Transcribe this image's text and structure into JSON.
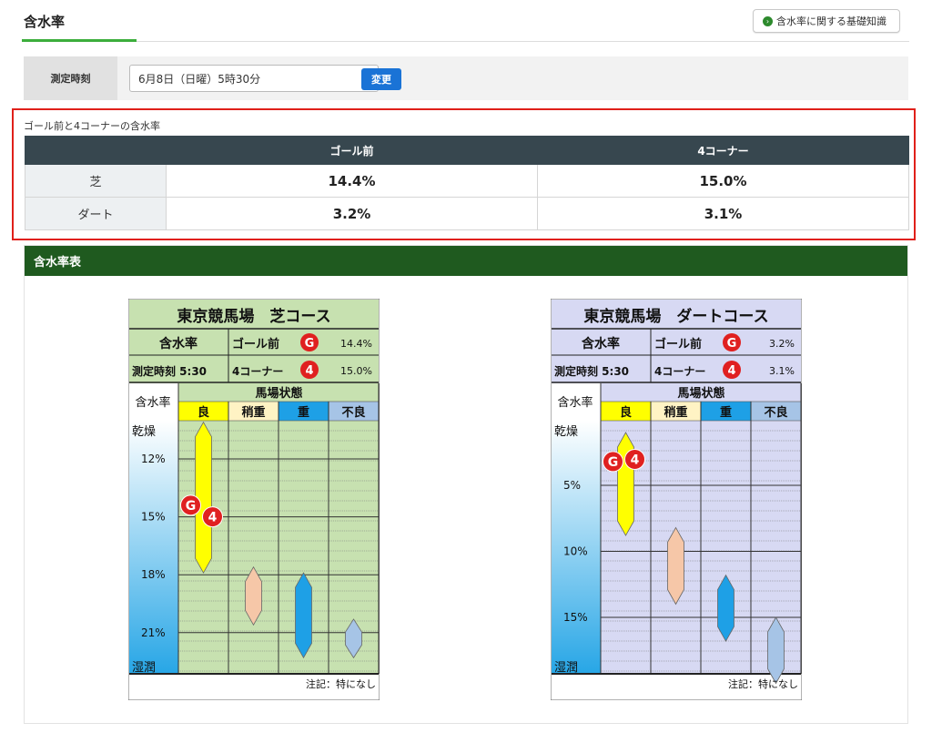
{
  "header": {
    "title": "含水率",
    "help_button": "含水率に関する基礎知識"
  },
  "control": {
    "label": "測定時刻",
    "selected": "6月8日（日曜）5時30分",
    "change_button": "変更"
  },
  "summary": {
    "caption": "ゴール前と4コーナーの含水率",
    "columns": [
      "ゴール前",
      "4コーナー"
    ],
    "rows": [
      {
        "label": "芝",
        "goal": "14.4%",
        "corner": "15.0%"
      },
      {
        "label": "ダート",
        "goal": "3.2%",
        "corner": "3.1%"
      }
    ]
  },
  "section": {
    "title": "含水率表"
  },
  "charts": {
    "turf": {
      "title": "東京競馬場　芝コース",
      "label_moisture": "含水率",
      "goal_label": "ゴール前",
      "goal_badge": "G",
      "goal_value": "14.4%",
      "time_label": "測定時刻 5:30",
      "corner_label": "4コーナー",
      "corner_badge": "4",
      "corner_value": "15.0%",
      "axis_title": "含水率",
      "track_condition": "馬場状態",
      "conditions": [
        "良",
        "稍重",
        "重",
        "不良"
      ],
      "axis_top": "乾燥",
      "axis_bottom": "湿潤",
      "ticks": [
        "12%",
        "15%",
        "18%",
        "21%"
      ],
      "note": "注記：特になし",
      "ranges": {
        "good": [
          10.1,
          17.9
        ],
        "slightly_heavy": [
          17.6,
          20.6
        ],
        "heavy": [
          17.9,
          22.3
        ],
        "bad": [
          20.3,
          22.3
        ]
      },
      "markers": {
        "goal": 14.4,
        "corner": 15.0
      },
      "colors": {
        "bg": "#c7e1b0",
        "border": "#333333"
      }
    },
    "dirt": {
      "title": "東京競馬場　ダートコース",
      "label_moisture": "含水率",
      "goal_label": "ゴール前",
      "goal_badge": "G",
      "goal_value": "3.2%",
      "time_label": "測定時刻 5:30",
      "corner_label": "4コーナー",
      "corner_badge": "4",
      "corner_value": "3.1%",
      "axis_title": "含水率",
      "track_condition": "馬場状態",
      "conditions": [
        "良",
        "稍重",
        "重",
        "不良"
      ],
      "axis_top": "乾燥",
      "axis_bottom": "湿潤",
      "ticks": [
        "5%",
        "10%",
        "15%"
      ],
      "note": "注記：特になし",
      "ranges": {
        "good": [
          1.0,
          8.8
        ],
        "slightly_heavy": [
          8.2,
          14.0
        ],
        "heavy": [
          11.8,
          16.8
        ],
        "bad": [
          15.0,
          20.0
        ]
      },
      "markers": {
        "goal": 3.2,
        "corner": 3.1
      },
      "colors": {
        "bg": "#d7d9f3",
        "border": "#333333"
      }
    }
  },
  "colors": {
    "accent_green": "#3cae3c",
    "button_blue": "#1a73d6",
    "table_header": "#37474f",
    "section_header": "#1f5a1f",
    "highlight_border": "#e0201a",
    "good": "#ffff00",
    "slightly_heavy": "#f6c7a8",
    "heavy": "#1ea0e6",
    "bad": "#a6c4e6"
  }
}
